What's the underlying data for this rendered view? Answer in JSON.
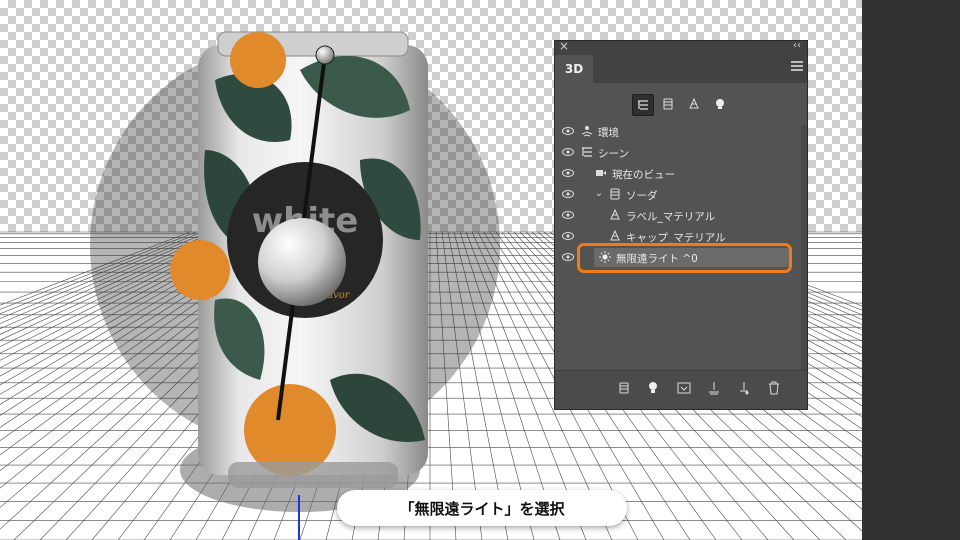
{
  "panel": {
    "tab_label": "3D",
    "close_glyph": "×",
    "collapse_glyph": "‹‹",
    "filter_icons": [
      "scene-filter-icon",
      "mesh-filter-icon",
      "material-filter-icon",
      "light-filter-icon"
    ],
    "layers": [
      {
        "label": "環境",
        "icon": "environment-icon",
        "indent": 0,
        "visible": true,
        "expander": false
      },
      {
        "label": "シーン",
        "icon": "scene-icon",
        "indent": 0,
        "visible": true,
        "expander": false
      },
      {
        "label": "現在のビュー",
        "icon": "camera-icon",
        "indent": 1,
        "visible": true,
        "expander": false
      },
      {
        "label": "ソーダ",
        "icon": "mesh-icon",
        "indent": 1,
        "visible": true,
        "expander": true
      },
      {
        "label": "ラベル_マテリアル",
        "icon": "material-icon",
        "indent": 2,
        "visible": true,
        "expander": false
      },
      {
        "label": "キャップ_マテリアル",
        "icon": "material-icon",
        "indent": 2,
        "visible": true,
        "expander": false
      },
      {
        "label": "無限遠ライト ^0",
        "icon": "infinite-light-icon",
        "indent": 0,
        "visible": true,
        "expander": false,
        "selected": true
      }
    ],
    "bottom_icons": [
      "new-mesh-icon",
      "add-light-icon",
      "render-icon",
      "ground-icon",
      "anchor-icon",
      "trash-icon"
    ]
  },
  "can": {
    "label_text": "white",
    "sub_text": "flavor"
  },
  "caption": "「無限遠ライト」を選択",
  "colors": {
    "highlight": "#f07b1b",
    "panel_bg": "#535353"
  }
}
